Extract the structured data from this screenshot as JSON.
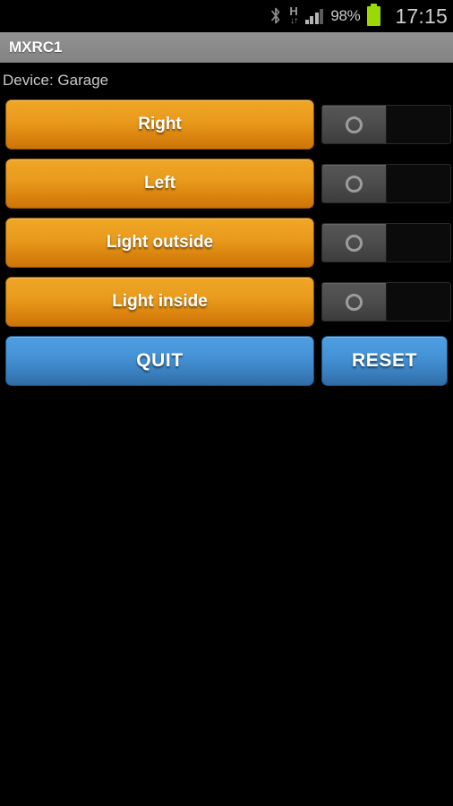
{
  "status_bar": {
    "bluetooth_icon": "bluetooth-icon",
    "network_type": "H",
    "network_arrows": "↓↑",
    "signal_icon": "signal-bars-icon",
    "signal_bars_filled": 3,
    "signal_bars_total": 4,
    "battery_percent": "98%",
    "battery_icon": "battery-full-icon",
    "clock": "17:15"
  },
  "action_bar": {
    "title": "MXRC1"
  },
  "main": {
    "device_label": "Device: Garage",
    "controls": [
      {
        "label": "Right",
        "toggle_state": "off",
        "toggle_icon": "circle-outline-icon"
      },
      {
        "label": "Left",
        "toggle_state": "off",
        "toggle_icon": "circle-outline-icon"
      },
      {
        "label": "Light outside",
        "toggle_state": "off",
        "toggle_icon": "circle-outline-icon"
      },
      {
        "label": "Light inside",
        "toggle_state": "off",
        "toggle_icon": "circle-outline-icon"
      }
    ],
    "quit_label": "QUIT",
    "reset_label": "RESET"
  },
  "colors": {
    "background": "#000000",
    "action_bar": "#8a8a8a",
    "button_orange_top": "#f0a626",
    "button_orange_bottom": "#ce7409",
    "button_blue_top": "#4f9fe0",
    "button_blue_bottom": "#2f6ca6",
    "battery_green": "#9bd905",
    "text_light": "#c9c9c9"
  }
}
